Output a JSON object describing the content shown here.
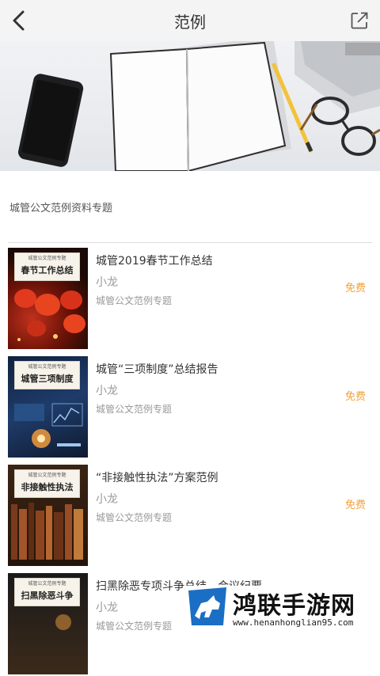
{
  "header": {
    "title": "范例"
  },
  "section_title": "城管公文范例资料专题",
  "items": [
    {
      "thumb_small": "城管公文范例专题",
      "thumb_big": "春节工作总结",
      "title": "城管2019春节工作总结",
      "author": "小龙",
      "topic": "城管公文范例专题",
      "price": "免费"
    },
    {
      "thumb_small": "城管公文范例专题",
      "thumb_big": "城管三项制度",
      "title": "城管“三项制度”总结报告",
      "author": "小龙",
      "topic": "城管公文范例专题",
      "price": "免费"
    },
    {
      "thumb_small": "城管公文范例专题",
      "thumb_big": "非接触性执法",
      "title": "“非接触性执法”方案范例",
      "author": "小龙",
      "topic": "城管公文范例专题",
      "price": "免费"
    },
    {
      "thumb_small": "城管公文范例专题",
      "thumb_big": "扫黑除恶斗争",
      "title": "扫黑除恶专项斗争总结、会议纪要",
      "author": "小龙",
      "topic": "城管公文范例专题",
      "price": ""
    }
  ],
  "watermark": {
    "text": "鸿联手游网",
    "url": "www.henanhonglian95.com"
  },
  "colors": {
    "accent_price": "#f2a23a",
    "header_bg": "#f4f4f4"
  }
}
